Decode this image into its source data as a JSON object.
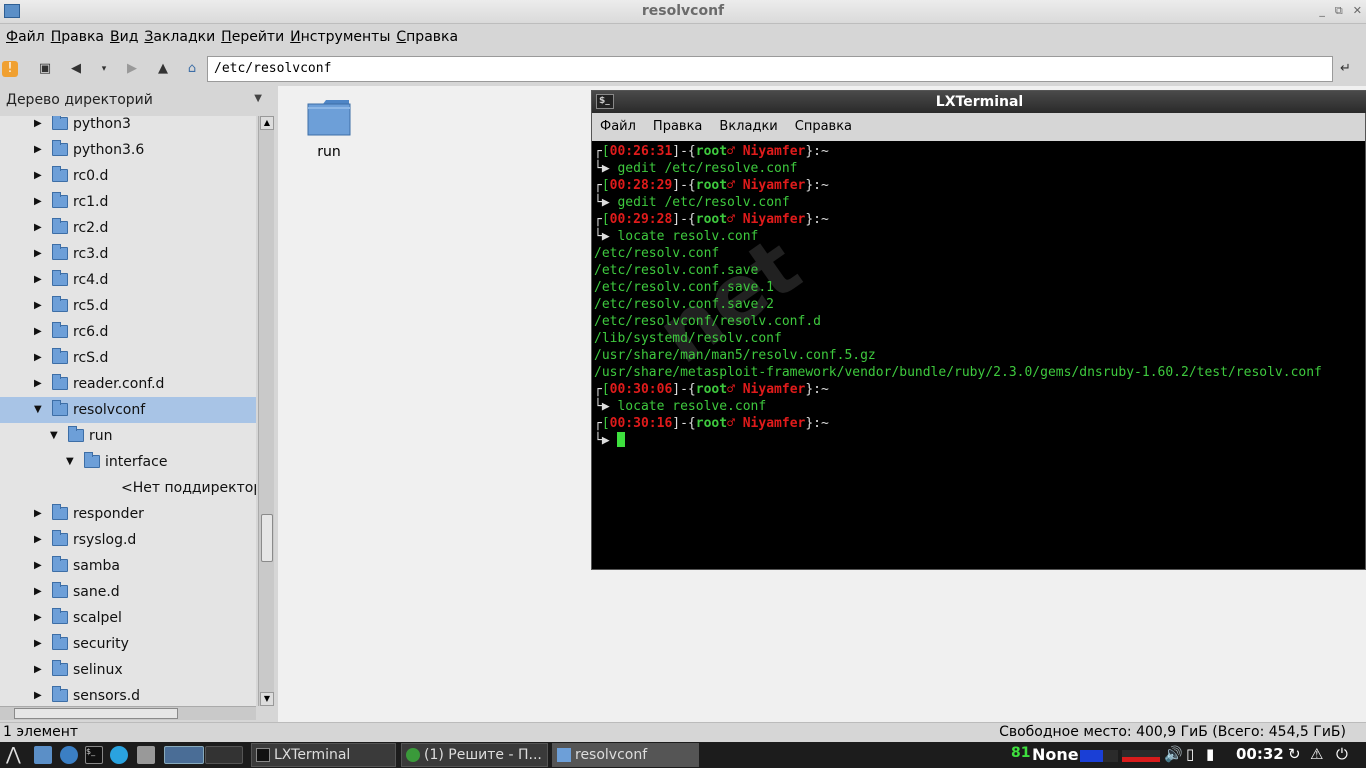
{
  "window": {
    "title": "resolvconf",
    "buttons": [
      "_",
      "⧉",
      "✕"
    ]
  },
  "menubar": [
    {
      "first": "Ф",
      "rest": "айл"
    },
    {
      "first": "П",
      "rest": "равка"
    },
    {
      "first": "В",
      "rest": "ид"
    },
    {
      "first": "З",
      "rest": "акладки"
    },
    {
      "first": "П",
      "rest": "ерейти"
    },
    {
      "first": "И",
      "rest": "нструменты"
    },
    {
      "first": "С",
      "rest": "правка"
    }
  ],
  "toolbar": {
    "path": "/etc/resolvconf"
  },
  "sidebar": {
    "header": "Дерево директорий",
    "nodes": [
      {
        "label": "python3",
        "level": 0,
        "arrow": "▶"
      },
      {
        "label": "python3.6",
        "level": 0,
        "arrow": "▶"
      },
      {
        "label": "rc0.d",
        "level": 0,
        "arrow": "▶"
      },
      {
        "label": "rc1.d",
        "level": 0,
        "arrow": "▶"
      },
      {
        "label": "rc2.d",
        "level": 0,
        "arrow": "▶"
      },
      {
        "label": "rc3.d",
        "level": 0,
        "arrow": "▶"
      },
      {
        "label": "rc4.d",
        "level": 0,
        "arrow": "▶"
      },
      {
        "label": "rc5.d",
        "level": 0,
        "arrow": "▶"
      },
      {
        "label": "rc6.d",
        "level": 0,
        "arrow": "▶"
      },
      {
        "label": "rcS.d",
        "level": 0,
        "arrow": "▶"
      },
      {
        "label": "reader.conf.d",
        "level": 0,
        "arrow": "▶"
      },
      {
        "label": "resolvconf",
        "level": 0,
        "arrow": "▼",
        "selected": true
      },
      {
        "label": "run",
        "level": 1,
        "arrow": "▼"
      },
      {
        "label": "interface",
        "level": 2,
        "arrow": "▼"
      },
      {
        "label": "<Нет поддиректори",
        "level": 3,
        "arrow": "",
        "nofolder": true
      },
      {
        "label": "responder",
        "level": 0,
        "arrow": "▶"
      },
      {
        "label": "rsyslog.d",
        "level": 0,
        "arrow": "▶"
      },
      {
        "label": "samba",
        "level": 0,
        "arrow": "▶"
      },
      {
        "label": "sane.d",
        "level": 0,
        "arrow": "▶"
      },
      {
        "label": "scalpel",
        "level": 0,
        "arrow": "▶"
      },
      {
        "label": "security",
        "level": 0,
        "arrow": "▶"
      },
      {
        "label": "selinux",
        "level": 0,
        "arrow": "▶"
      },
      {
        "label": "sensors.d",
        "level": 0,
        "arrow": "▶"
      }
    ]
  },
  "files": [
    {
      "name": "run"
    }
  ],
  "terminal": {
    "title": "LXTerminal",
    "menu": [
      "Файл",
      "Правка",
      "Вкладки",
      "Справка"
    ],
    "lines": [
      {
        "kind": "prompt",
        "time": "00:26:31",
        "user": "root",
        "sym": "♂",
        "host": "Niyamfer",
        "tail": "}:~"
      },
      {
        "kind": "cmd",
        "text": "gedit /etc/resolve.conf"
      },
      {
        "kind": "prompt",
        "time": "00:28:29",
        "user": "root",
        "sym": "♂",
        "host": "Niyamfer",
        "tail": "}:~"
      },
      {
        "kind": "cmd",
        "text": "gedit /etc/resolv.conf"
      },
      {
        "kind": "prompt",
        "time": "00:29:28",
        "user": "root",
        "sym": "♂",
        "host": "Niyamfer",
        "tail": "}:~"
      },
      {
        "kind": "cmd",
        "text": "locate resolv.conf"
      },
      {
        "kind": "out",
        "text": "/etc/resolv.conf"
      },
      {
        "kind": "out",
        "text": "/etc/resolv.conf.save"
      },
      {
        "kind": "out",
        "text": "/etc/resolv.conf.save.1"
      },
      {
        "kind": "out",
        "text": "/etc/resolv.conf.save.2"
      },
      {
        "kind": "out",
        "text": "/etc/resolvconf/resolv.conf.d"
      },
      {
        "kind": "out",
        "text": "/lib/systemd/resolv.conf"
      },
      {
        "kind": "out",
        "text": "/usr/share/man/man5/resolv.conf.5.gz"
      },
      {
        "kind": "out",
        "text": "/usr/share/metasploit-framework/vendor/bundle/ruby/2.3.0/gems/dnsruby-1.60.2/test/resolv.conf"
      },
      {
        "kind": "prompt",
        "time": "00:30:06",
        "user": "root",
        "sym": "♂",
        "host": "Niyamfer",
        "tail": "}:~"
      },
      {
        "kind": "cmd",
        "text": "locate resolve.conf"
      },
      {
        "kind": "prompt",
        "time": "00:30:16",
        "user": "root",
        "sym": "♂",
        "host": "Niyamfer",
        "tail": "}:~"
      },
      {
        "kind": "cursor",
        "text": ""
      }
    ],
    "watermark": "net"
  },
  "statusbar": {
    "left": "1 элемент",
    "right": "Свободное место: 400,9 ГиБ (Всего: 454,5 ГиБ)"
  },
  "taskbar": {
    "tasks": [
      {
        "label": "LXTerminal"
      },
      {
        "label": "(1) Решите - П..."
      },
      {
        "label": "resolvconf"
      }
    ],
    "tray": {
      "cpu": "81",
      "none": "None",
      "clock": "00:32"
    }
  },
  "colors": {
    "selection": "#a8c4e6",
    "terminal_green": "#3ec93e",
    "terminal_red": "#e01b1b",
    "folder": "#6d9fd8"
  }
}
